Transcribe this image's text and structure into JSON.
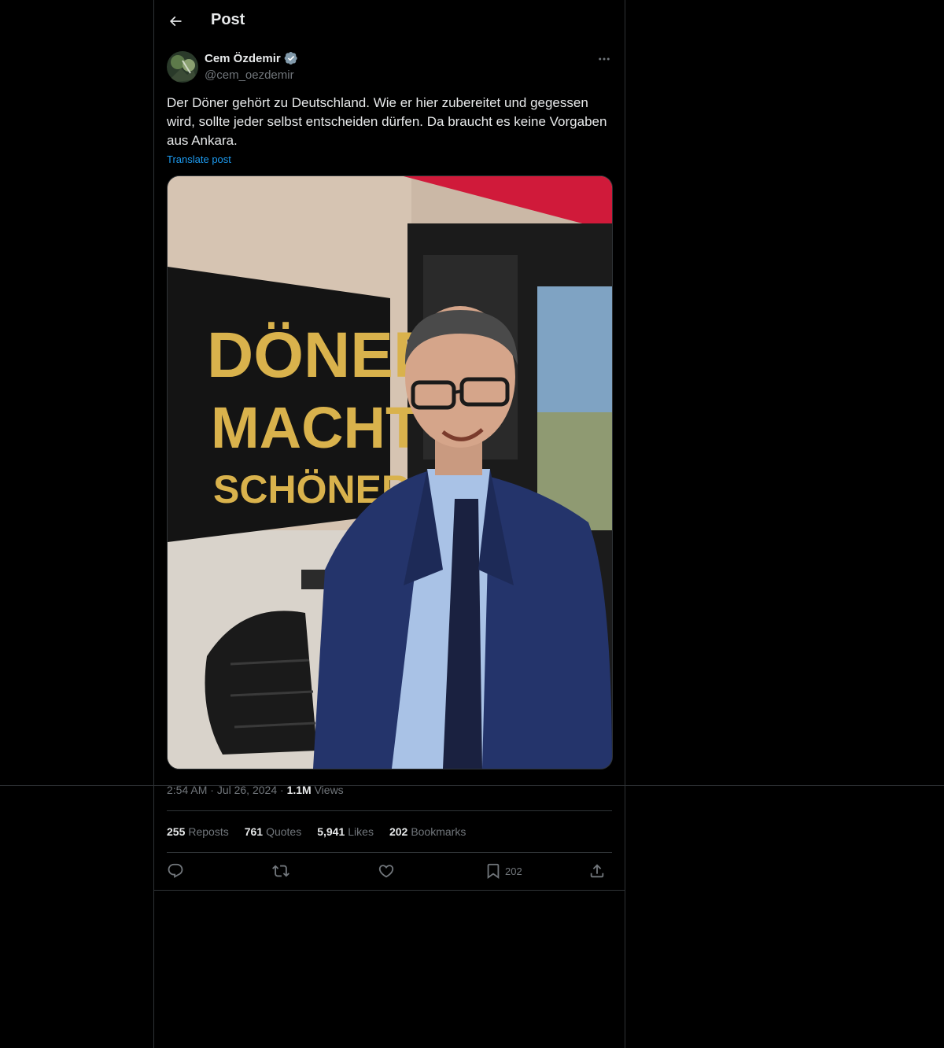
{
  "header": {
    "title": "Post"
  },
  "author": {
    "name": "Cem Özdemir",
    "handle": "@cem_oezdemir",
    "verified": true
  },
  "post": {
    "text": "Der Döner gehört zu Deutschland. Wie er hier zubereitet und gegessen wird, sollte jeder selbst entscheiden dürfen. Da braucht es keine Vorgaben aus Ankara.",
    "translate_label": "Translate post",
    "image_sign_lines": [
      "DÖNER",
      "MACHT",
      "SCHÖNER"
    ]
  },
  "meta": {
    "time": "2:54 AM",
    "sep": "·",
    "date": "Jul 26, 2024",
    "views_count": "1.1M",
    "views_label": "Views"
  },
  "stats": {
    "reposts_count": "255",
    "reposts_label": "Reposts",
    "quotes_count": "761",
    "quotes_label": "Quotes",
    "likes_count": "5,941",
    "likes_label": "Likes",
    "bookmarks_count": "202",
    "bookmarks_label": "Bookmarks"
  },
  "actions": {
    "bookmark_count": "202"
  },
  "colors": {
    "background": "#000000",
    "text": "#e7e9ea",
    "secondary": "#71767b",
    "link": "#1d9bf0",
    "border": "#2f3336"
  },
  "icons": [
    "back-arrow-icon",
    "verified-icon",
    "more-icon",
    "reply-icon",
    "repost-icon",
    "like-icon",
    "bookmark-icon",
    "share-icon"
  ]
}
